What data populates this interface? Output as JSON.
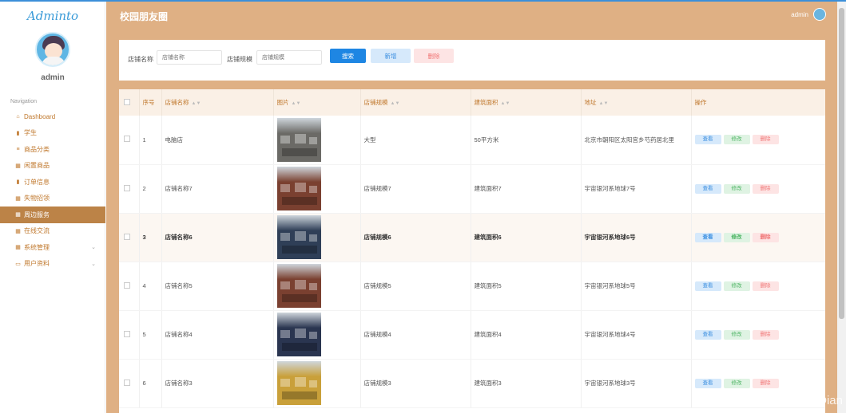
{
  "app": {
    "brand": "Adminto",
    "page_title": "校园朋友圈",
    "header_user": "admin"
  },
  "sidebar": {
    "username": "admin",
    "nav_heading": "Navigation",
    "items": [
      {
        "label": "Dashboard",
        "icon": "home-icon",
        "active": false,
        "has_arrow": false
      },
      {
        "label": "学生",
        "icon": "clipboard-icon",
        "active": false,
        "has_arrow": false
      },
      {
        "label": "商品分类",
        "icon": "list-icon",
        "active": false,
        "has_arrow": false
      },
      {
        "label": "闲置商品",
        "icon": "grid-icon",
        "active": false,
        "has_arrow": false
      },
      {
        "label": "订单信息",
        "icon": "clipboard-icon",
        "active": false,
        "has_arrow": false
      },
      {
        "label": "失物招领",
        "icon": "grid-icon",
        "active": false,
        "has_arrow": false
      },
      {
        "label": "周边服务",
        "icon": "grid-icon",
        "active": true,
        "has_arrow": false
      },
      {
        "label": "在线交流",
        "icon": "grid-icon",
        "active": false,
        "has_arrow": false
      },
      {
        "label": "系统管理",
        "icon": "grid-icon",
        "active": false,
        "has_arrow": true
      },
      {
        "label": "用户资料",
        "icon": "card-icon",
        "active": false,
        "has_arrow": true
      }
    ]
  },
  "search": {
    "name_label": "店铺名称",
    "name_placeholder": "店铺名称",
    "scale_label": "店铺规模",
    "scale_placeholder": "店铺规模",
    "search_btn": "搜索",
    "add_btn": "新增",
    "delete_btn": "删除"
  },
  "table": {
    "headers": [
      "序号",
      "店铺名称",
      "图片",
      "店铺规模",
      "建筑面积",
      "地址",
      "操作"
    ],
    "actions": {
      "view": "查看",
      "edit": "修改",
      "delete": "删除"
    },
    "rows": [
      {
        "index": "1",
        "name": "电脑店",
        "scale": "大型",
        "area": "50平方米",
        "address": "北京市朝阳区太阳宫乡芍药居北里",
        "highlight": false,
        "img": "#6b6a66"
      },
      {
        "index": "2",
        "name": "店铺名称7",
        "scale": "店铺规模7",
        "area": "建筑面积7",
        "address": "宇宙银河系地球7号",
        "highlight": false,
        "img": "#7a4030"
      },
      {
        "index": "3",
        "name": "店铺名称6",
        "scale": "店铺规模6",
        "area": "建筑面积6",
        "address": "宇宙银河系地球6号",
        "highlight": true,
        "img": "#2f3f57"
      },
      {
        "index": "4",
        "name": "店铺名称5",
        "scale": "店铺规模5",
        "area": "建筑面积5",
        "address": "宇宙银河系地球5号",
        "highlight": false,
        "img": "#7a4030"
      },
      {
        "index": "5",
        "name": "店铺名称4",
        "scale": "店铺规模4",
        "area": "建筑面积4",
        "address": "宇宙银河系地球4号",
        "highlight": false,
        "img": "#2a3550"
      },
      {
        "index": "6",
        "name": "店铺名称3",
        "scale": "店铺规模3",
        "area": "建筑面积3",
        "address": "宇宙银河系地球3号",
        "highlight": false,
        "img": "#c9a03a"
      }
    ]
  },
  "watermark": "CSDN @计算机YiDian",
  "colors": {
    "accent": "#dfb084",
    "active_nav": "#bc8347",
    "primary": "#1e86e3"
  }
}
